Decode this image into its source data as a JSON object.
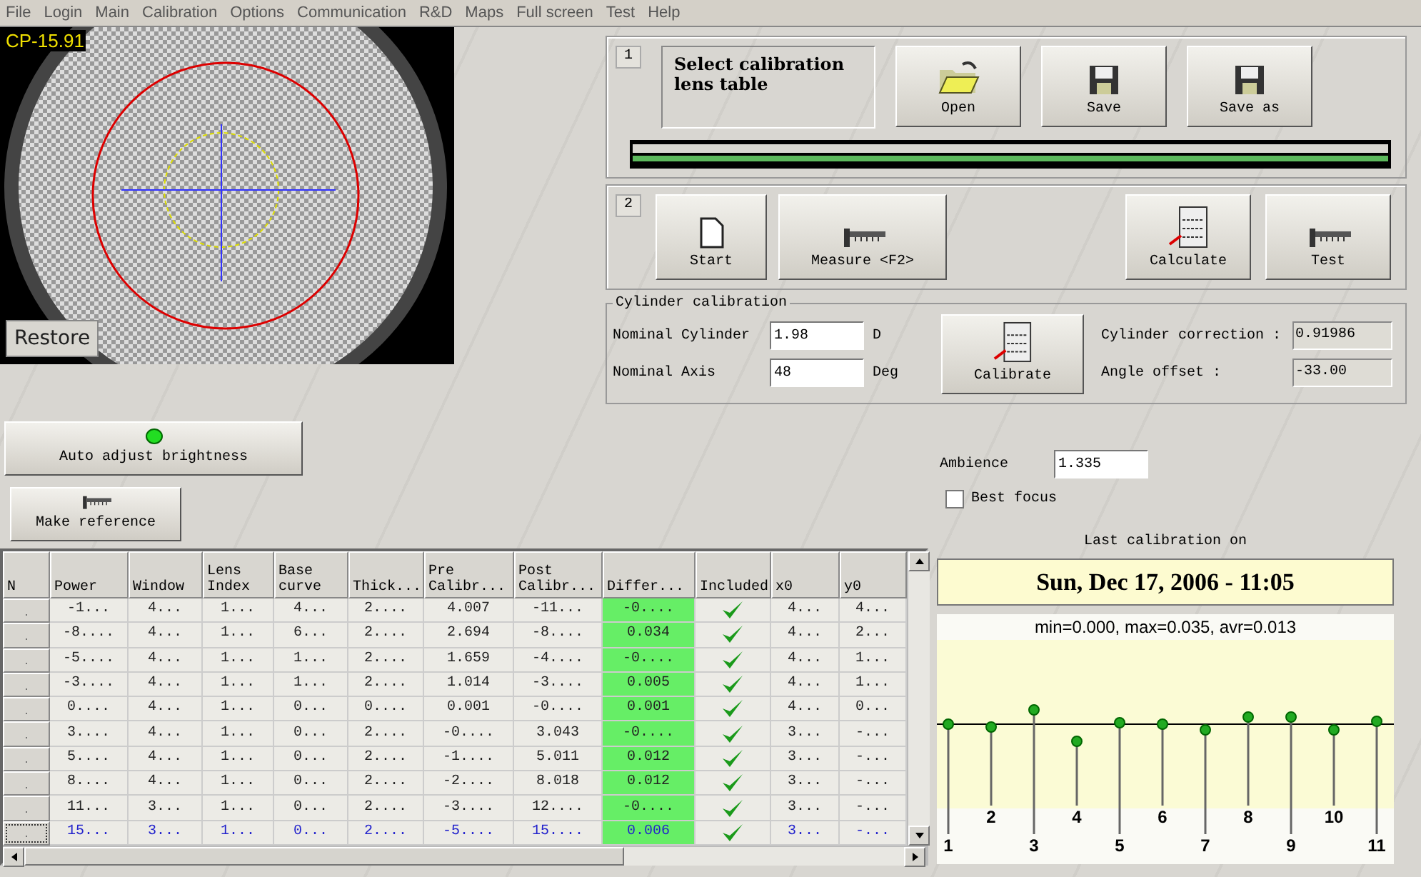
{
  "menu": [
    "File",
    "Login",
    "Main",
    "Calibration",
    "Options",
    "Communication",
    "R&D",
    "Maps",
    "Full screen",
    "Test",
    "Help"
  ],
  "camera": {
    "overlay_label": "CP-15.91",
    "restore_button": "Restore"
  },
  "brightness": {
    "label": "Auto adjust brightness",
    "on": true
  },
  "make_reference": "Make reference",
  "step1": {
    "number": "1",
    "title": "Select calibration lens table",
    "buttons": [
      {
        "label": "Open",
        "kind": "folder"
      },
      {
        "label": "Save",
        "kind": "disk"
      },
      {
        "label": "Save as",
        "kind": "disk"
      }
    ]
  },
  "step2": {
    "number": "2",
    "left_buttons": [
      {
        "label": "Start",
        "kind": "page"
      },
      {
        "label": "Measure <F2>",
        "kind": "caliper"
      }
    ],
    "right_buttons": [
      {
        "label": "Calculate",
        "kind": "calculator"
      },
      {
        "label": "Test",
        "kind": "caliper"
      }
    ]
  },
  "cylinder": {
    "title": "Cylinder calibration",
    "fields": [
      {
        "label": "Nominal Cylinder",
        "value": "1.98",
        "unit": "D"
      },
      {
        "label": "Nominal Axis",
        "value": "48",
        "unit": "Deg"
      }
    ],
    "button": "Calibrate",
    "results": [
      {
        "label": "Cylinder correction :",
        "value": "0.91986"
      },
      {
        "label": "Angle offset :",
        "value": "-33.00"
      }
    ]
  },
  "ambience": {
    "label": "Ambience",
    "value": "1.335"
  },
  "best_focus": {
    "label": "Best focus",
    "checked": false
  },
  "last_calibration": {
    "label": "Last calibration on",
    "date": "Sun, Dec 17, 2006 - 11:05"
  },
  "chart": {
    "title": "min=0.000, max=0.035, avr=0.013",
    "point_labels": [
      "1",
      "2",
      "3",
      "4",
      "5",
      "6",
      "7",
      "8",
      "9",
      "10",
      "11"
    ]
  },
  "table": {
    "columns": [
      "N",
      "Power",
      "Window",
      "Lens\nIndex",
      "Base\ncurve",
      "Thick...",
      "Pre\nCalibr...",
      "Post\nCalibr...",
      "Differ...",
      "Included",
      "x0",
      "y0"
    ],
    "rows": [
      {
        "cells": [
          ".",
          "-1...",
          "4...",
          "1...",
          "4...",
          "2....",
          "4.007",
          "-11...",
          "-0....",
          "",
          "4...",
          "4..."
        ],
        "included": true,
        "selected": false
      },
      {
        "cells": [
          ".",
          "-8....",
          "4...",
          "1...",
          "6...",
          "2....",
          "2.694",
          "-8....",
          "0.034",
          "",
          "4...",
          "2..."
        ],
        "included": true,
        "selected": false
      },
      {
        "cells": [
          ".",
          "-5....",
          "4...",
          "1...",
          "1...",
          "2....",
          "1.659",
          "-4....",
          "-0....",
          "",
          "4...",
          "1..."
        ],
        "included": true,
        "selected": false
      },
      {
        "cells": [
          ".",
          "-3....",
          "4...",
          "1...",
          "1...",
          "2....",
          "1.014",
          "-3....",
          "0.005",
          "",
          "4...",
          "1..."
        ],
        "included": true,
        "selected": false
      },
      {
        "cells": [
          ".",
          "0....",
          "4...",
          "1...",
          "0...",
          "0....",
          "0.001",
          "-0....",
          "0.001",
          "",
          "4...",
          "0..."
        ],
        "included": true,
        "selected": false
      },
      {
        "cells": [
          ".",
          "3....",
          "4...",
          "1...",
          "0...",
          "2....",
          "-0....",
          "3.043",
          "-0....",
          "",
          "3...",
          "-..."
        ],
        "included": true,
        "selected": false
      },
      {
        "cells": [
          ".",
          "5....",
          "4...",
          "1...",
          "0...",
          "2....",
          "-1....",
          "5.011",
          "0.012",
          "",
          "3...",
          "-..."
        ],
        "included": true,
        "selected": false
      },
      {
        "cells": [
          ".",
          "8....",
          "4...",
          "1...",
          "0...",
          "2....",
          "-2....",
          "8.018",
          "0.012",
          "",
          "3...",
          "-..."
        ],
        "included": true,
        "selected": false
      },
      {
        "cells": [
          ".",
          "11...",
          "3...",
          "1...",
          "0...",
          "2....",
          "-3....",
          "12....",
          "-0....",
          "",
          "3...",
          "-..."
        ],
        "included": true,
        "selected": false
      },
      {
        "cells": [
          ".",
          "15...",
          "3...",
          "1...",
          "0...",
          "2....",
          "-5....",
          "15....",
          "0.006",
          "",
          "3...",
          "-..."
        ],
        "included": true,
        "selected": true
      }
    ]
  }
}
